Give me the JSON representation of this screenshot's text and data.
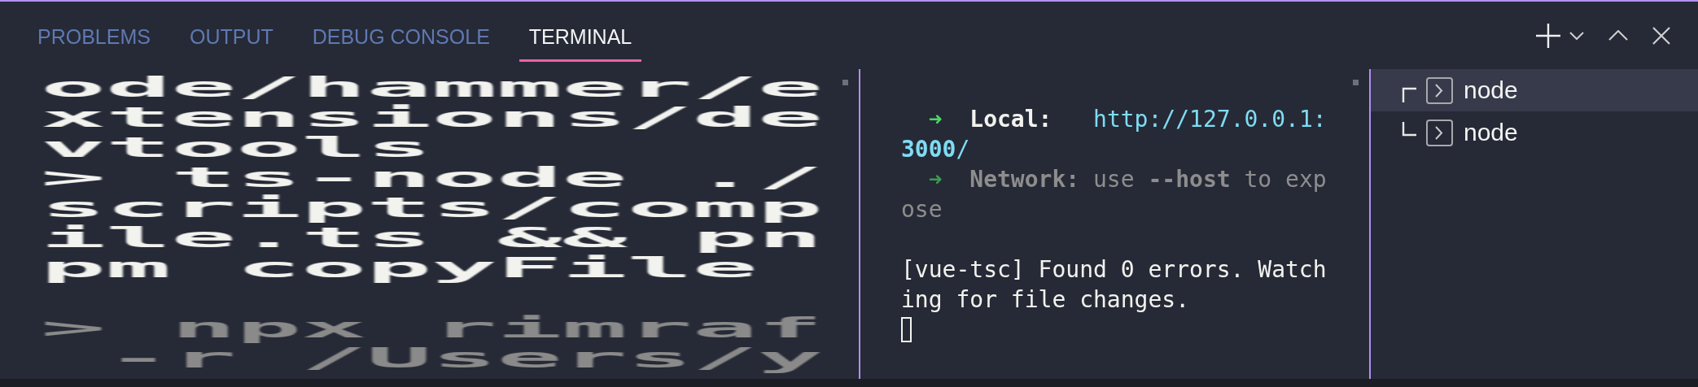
{
  "tabs": [
    {
      "label": "PROBLEMS",
      "selected": false
    },
    {
      "label": "OUTPUT",
      "selected": false
    },
    {
      "label": "DEBUG CONSOLE",
      "selected": false
    },
    {
      "label": "TERMINAL",
      "selected": true
    }
  ],
  "terminals": [
    {
      "kind": "zoomed",
      "lines": [
        {
          "kind": "bright",
          "segments": [
            {
              "kind": "plain",
              "text": "ode/hammer/e"
            }
          ]
        },
        {
          "kind": "bright",
          "segments": [
            {
              "kind": "plain",
              "text": "xtensions/de"
            }
          ]
        },
        {
          "kind": "bright",
          "segments": [
            {
              "kind": "plain",
              "text": "vtools"
            }
          ]
        },
        {
          "kind": "bright",
          "segments": [
            {
              "kind": "plain",
              "text": "> ts-node ./"
            }
          ]
        },
        {
          "kind": "bright",
          "segments": [
            {
              "kind": "plain",
              "text": "scripts/comp"
            }
          ]
        },
        {
          "kind": "bright",
          "segments": [
            {
              "kind": "plain",
              "text": "ile.ts && pn"
            }
          ]
        },
        {
          "kind": "bright",
          "segments": [
            {
              "kind": "plain",
              "text": "pm copyFile"
            }
          ]
        },
        {
          "kind": "blank"
        },
        {
          "kind": "dim",
          "segments": [
            {
              "kind": "plain",
              "text": "> npx rimraf"
            }
          ]
        },
        {
          "kind": "dim",
          "segments": [
            {
              "kind": "plain",
              "text": " -r /Users/y"
            }
          ]
        }
      ]
    },
    {
      "kind": "normal",
      "lines": [
        {
          "kind": "blank"
        },
        {
          "kind": "text",
          "segments": [
            {
              "kind": "arrow",
              "text": "  ➜  "
            },
            {
              "kind": "label",
              "text": "Local:"
            },
            {
              "kind": "url",
              "text": "   http://127.0.0.1:"
            }
          ]
        },
        {
          "kind": "text",
          "segments": [
            {
              "kind": "url-bold",
              "text": "3000"
            },
            {
              "kind": "url",
              "text": "/"
            }
          ]
        },
        {
          "kind": "text",
          "segments": [
            {
              "kind": "arrow-dim",
              "text": "  ➜  "
            },
            {
              "kind": "dim-bold",
              "text": "Network:"
            },
            {
              "kind": "dim",
              "text": " use "
            },
            {
              "kind": "dim-bold",
              "text": "--host"
            },
            {
              "kind": "dim",
              "text": " to exp"
            }
          ]
        },
        {
          "kind": "text",
          "segments": [
            {
              "kind": "dim",
              "text": "ose"
            }
          ]
        },
        {
          "kind": "blank"
        },
        {
          "kind": "text",
          "segments": [
            {
              "kind": "plain",
              "text": "[vue-tsc] Found 0 errors. Watch"
            }
          ]
        },
        {
          "kind": "text",
          "segments": [
            {
              "kind": "plain",
              "text": "ing for file changes."
            }
          ]
        },
        {
          "kind": "cursor"
        }
      ]
    }
  ],
  "terminal_list": [
    {
      "label": "node",
      "selected": true
    },
    {
      "label": "node",
      "selected": false
    }
  ]
}
